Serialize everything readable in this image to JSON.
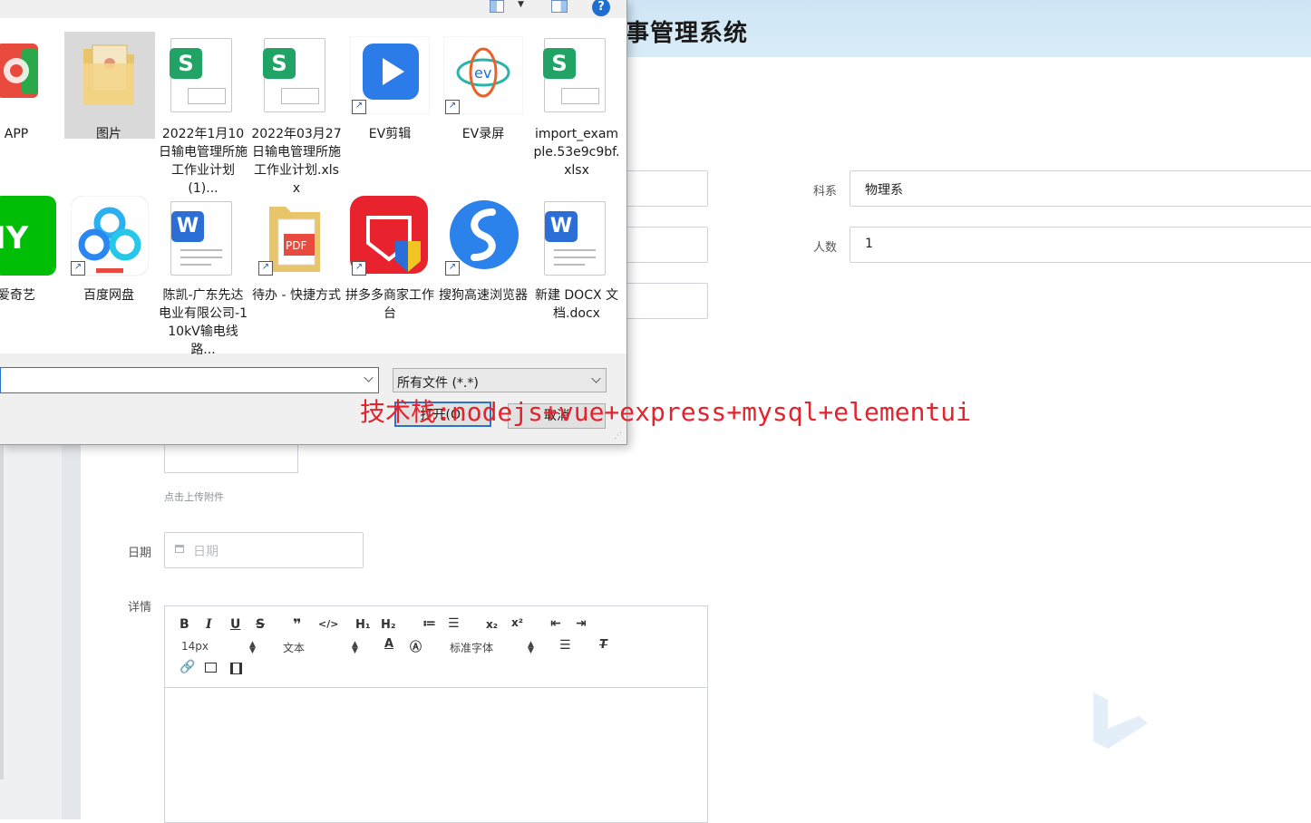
{
  "page": {
    "system_title": "事管理系统",
    "form": {
      "department_label": "科系",
      "department_value": "物理系",
      "count_label": "人数",
      "count_value": "1",
      "upload_hint": "点击上传附件",
      "date_label": "日期",
      "date_placeholder": "日期",
      "detail_label": "详情"
    },
    "editor": {
      "font_size": "14px",
      "text_format": "文本",
      "font_family": "标准字体",
      "buttons": [
        "B",
        "I",
        "U",
        "S",
        "❞",
        "</>",
        "H1",
        "H2",
        "ordered-list",
        "bullet-list",
        "subscript",
        "superscript",
        "outdent",
        "indent",
        "font-color",
        "background-color",
        "align",
        "clean",
        "link",
        "image",
        "video"
      ]
    }
  },
  "dialog": {
    "files": [
      {
        "name": "APP",
        "type": "app"
      },
      {
        "name": "图片",
        "type": "folder",
        "selected": true
      },
      {
        "name": "2022年1月10日输电管理所施工作业计划(1)...",
        "type": "xlsx"
      },
      {
        "name": "2022年03月27日输电管理所施工作业计划.xlsx",
        "type": "xlsx"
      },
      {
        "name": "EV剪辑",
        "type": "shortcut"
      },
      {
        "name": "EV录屏",
        "type": "shortcut"
      },
      {
        "name": "import_example.53e9c9bf.xlsx",
        "type": "xlsx"
      },
      {
        "name": "爱奇艺",
        "type": "app"
      },
      {
        "name": "百度网盘",
        "type": "shortcut"
      },
      {
        "name": "陈凯-广东先达电业有限公司-110kV输电线路...",
        "type": "docx"
      },
      {
        "name": "待办 - 快捷方式",
        "type": "shortcut"
      },
      {
        "name": "拼多多商家工作台",
        "type": "shortcut"
      },
      {
        "name": "搜狗高速浏览器",
        "type": "shortcut"
      },
      {
        "name": "新建 DOCX 文档.docx",
        "type": "docx"
      }
    ],
    "file_type_filter": "所有文件 (*.*)",
    "open_button": "打开(O)",
    "cancel_button": "取消",
    "help_icon": "?"
  },
  "overlay": {
    "tech_stack": "技术栈:nodejs+vue+express+mysql+elementui"
  },
  "colors": {
    "header_bg": "#d3e8f7",
    "overlay_red": "#e4232c",
    "selected_bg": "#cde8ff",
    "dialog_bg": "#f0f0f0",
    "accent_blue": "#2a73c5"
  }
}
